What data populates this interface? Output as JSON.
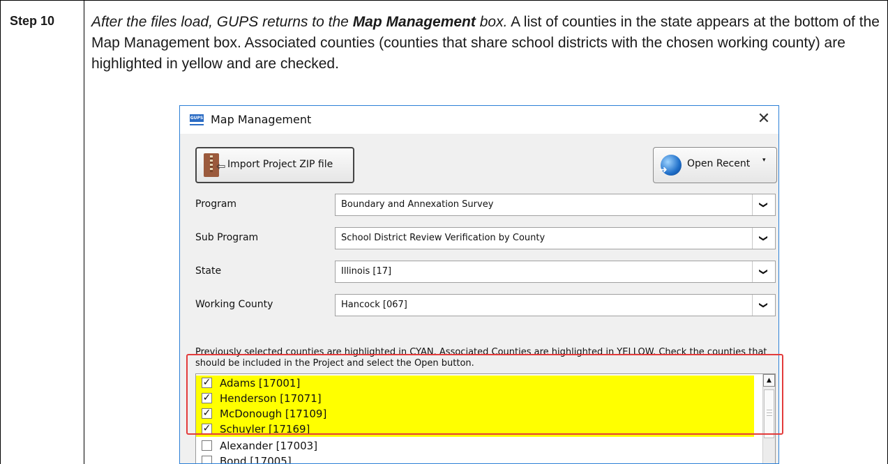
{
  "step": {
    "label": "Step 10"
  },
  "description": {
    "lead_part1": "After the files load, GUPS returns to the ",
    "lead_bold": "Map Management",
    "lead_part2": " box.",
    "body": " A list of counties in the state appears at the bottom of the Map Management box. Associated counties (counties that share school districts with the chosen working county) are highlighted in yellow and are checked."
  },
  "dialog": {
    "app_icon_text": "GUPS",
    "title": "Map Management",
    "close_symbol": "✕",
    "import_button": "Import Project ZIP file",
    "open_recent_button": "Open Recent",
    "open_recent_caret": "▾",
    "fields": [
      {
        "label": "Program",
        "value": "Boundary and Annexation Survey"
      },
      {
        "label": "Sub Program",
        "value": "School District Review Verification by County"
      },
      {
        "label": "State",
        "value": "Illinois [17]"
      },
      {
        "label": "Working County",
        "value": "Hancock [067]"
      }
    ],
    "dropdown_symbol": "❯",
    "note": "Previously selected counties are highlighted in CYAN. Associated Counties are highlighted in YELLOW. Check the counties that should be included in the Project and select the Open button.",
    "counties": [
      {
        "name": "Adams [17001]",
        "checked": true,
        "highlight": "#ffff00"
      },
      {
        "name": "Henderson [17071]",
        "checked": true,
        "highlight": "#ffff00"
      },
      {
        "name": "McDonough [17109]",
        "checked": true,
        "highlight": "#ffff00"
      },
      {
        "name": "Schuyler [17169]",
        "checked": true,
        "highlight": "#ffff00"
      },
      {
        "name": "Alexander [17003]",
        "checked": false,
        "highlight": ""
      },
      {
        "name": "Bond [17005]",
        "checked": false,
        "highlight": ""
      }
    ],
    "check_symbol": "✓",
    "scroll_up_symbol": "▲"
  },
  "colors": {
    "associated_highlight": "#ffff00",
    "callout_border": "#e33b3b",
    "dialog_border": "#2b7fd6"
  }
}
